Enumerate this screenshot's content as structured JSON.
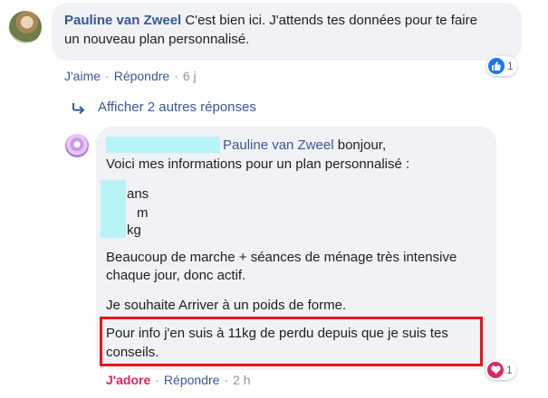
{
  "comment1": {
    "author": "Pauline van Zweel",
    "text_line1": "C'est bien ici. J'attends tes données pour te faire",
    "text_line2": "un nouveau plan personnalisé.",
    "reaction_count": "1",
    "actions": {
      "like": "J'aime",
      "reply": "Répondre",
      "time": "6 j"
    }
  },
  "show_replies": "Afficher 2 autres réponses",
  "comment2": {
    "mention": "Pauline van Zweel",
    "greeting": "bonjour,",
    "intro": "Voici mes informations pour un plan personnalisé :",
    "unit_age": "ans",
    "unit_height": "m",
    "unit_weight": "kg",
    "activity_line1": "Beaucoup de marche + séances de ménage très intensive",
    "activity_line2": "chaque jour, donc actif.",
    "goal": "Je souhaite Arriver à un poids de forme.",
    "info_line1": "Pour info j'en suis à 11kg de perdu depuis que je suis tes",
    "info_line2": "conseils.",
    "reaction_count": "1",
    "actions": {
      "reaction": "J'adore",
      "reply": "Répondre",
      "time": "2 h"
    }
  },
  "separator": "·",
  "colors": {
    "link": "#385898",
    "bubble": "#f0f2f5",
    "like": "#1877f2",
    "love": "#e0245e",
    "highlight_border": "#e8141b",
    "redaction": "#b8f3f8"
  },
  "icons": [
    "like-icon",
    "heart-icon",
    "reply-arrow-icon"
  ]
}
